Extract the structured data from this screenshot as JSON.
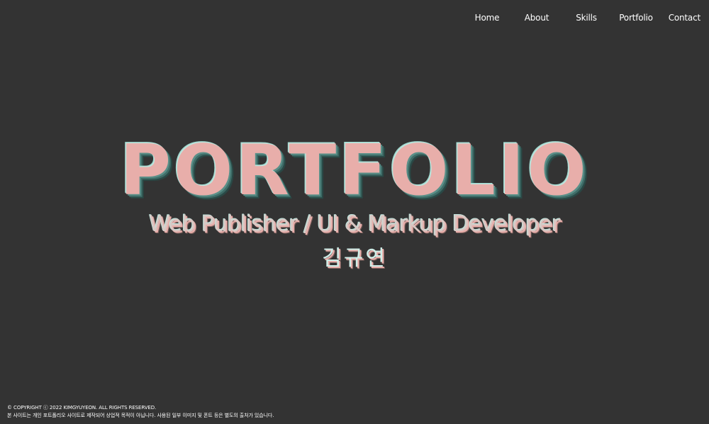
{
  "nav": {
    "items": [
      "Home",
      "About",
      "Skills",
      "Portfolio",
      "Contact"
    ]
  },
  "hero": {
    "title": "PORTFOLIO",
    "subtitle": "Web Publisher / UI & Markup Developer",
    "name": "김규연"
  },
  "footer": {
    "copyright": "© COPYRIGHT ⓒ 2022 KIMGYUYEON. ALL RIGHTS RESERVED.",
    "notice": "본 사이트는 개인 포트폴리오 사이트로 제작되어 상업적 목적이 아닙니다. 사용된 일부 이미지 및 폰트 등은 별도의 출처가 있습니다."
  },
  "colors": {
    "background": "#333333",
    "title_fill": "#e8aeaa",
    "title_shadow_accent": "#9fd6cc",
    "text_white": "#ffffff"
  }
}
